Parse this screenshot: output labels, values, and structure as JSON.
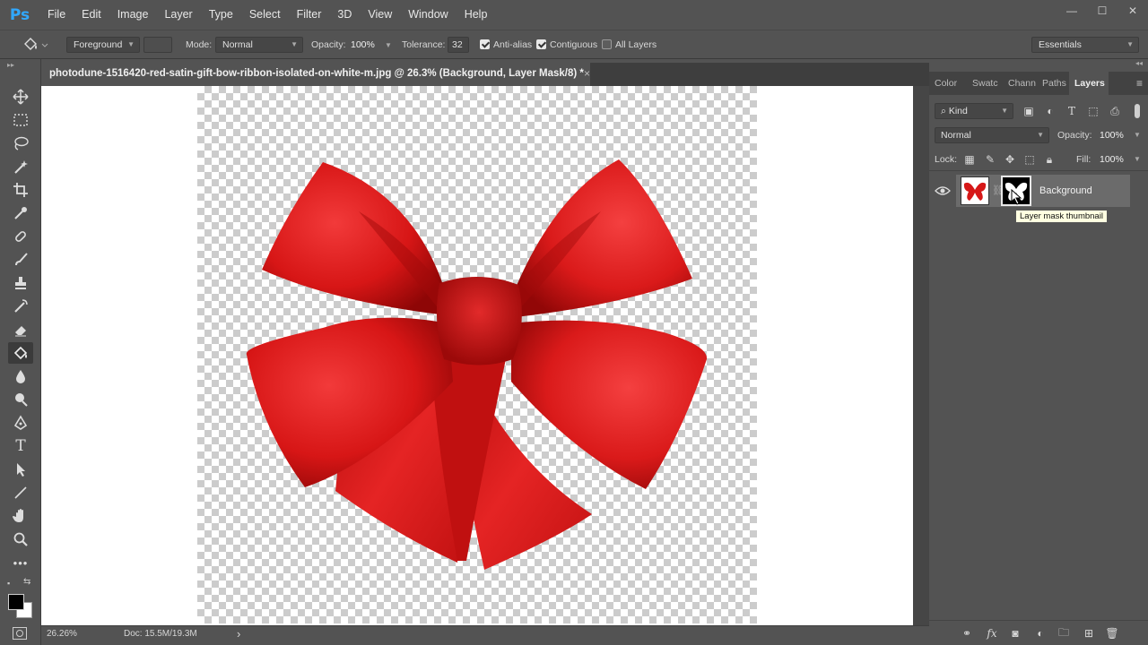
{
  "app": {
    "logo": "Ps"
  },
  "menu": [
    "File",
    "Edit",
    "Image",
    "Layer",
    "Type",
    "Select",
    "Filter",
    "3D",
    "View",
    "Window",
    "Help"
  ],
  "window_controls": {
    "minimize": "—",
    "maximize": "☐",
    "close": "✕"
  },
  "options": {
    "fill_source": "Foreground",
    "mode_label": "Mode:",
    "mode_value": "Normal",
    "opacity_label": "Opacity:",
    "opacity_value": "100%",
    "tolerance_label": "Tolerance:",
    "tolerance_value": "32",
    "anti_alias": {
      "label": "Anti-alias",
      "checked": true
    },
    "contiguous": {
      "label": "Contiguous",
      "checked": true
    },
    "all_layers": {
      "label": "All Layers",
      "checked": false
    },
    "workspace": "Essentials"
  },
  "document": {
    "tab_title": "photodune-1516420-red-satin-gift-bow-ribbon-isolated-on-white-m.jpg @ 26.3% (Background, Layer Mask/8) *",
    "close": "×"
  },
  "status": {
    "zoom": "26.26%",
    "doc": "Doc: 15.5M/19.3M",
    "arrow": "›"
  },
  "panels": {
    "tabs": [
      "Color",
      "Swatc",
      "Chann",
      "Paths",
      "Layers"
    ],
    "active_tab": "Layers",
    "filter_kind": "Kind",
    "blend_mode": "Normal",
    "opacity_label": "Opacity:",
    "opacity_value": "100%",
    "lock_label": "Lock:",
    "fill_label": "Fill:",
    "fill_value": "100%",
    "layers": [
      {
        "name": "Background",
        "visible": true,
        "has_mask": true
      }
    ],
    "tooltip": "Layer mask thumbnail"
  },
  "colors": {
    "foreground": "#000000",
    "background": "#ffffff",
    "bow_red": "#e21a1a"
  }
}
